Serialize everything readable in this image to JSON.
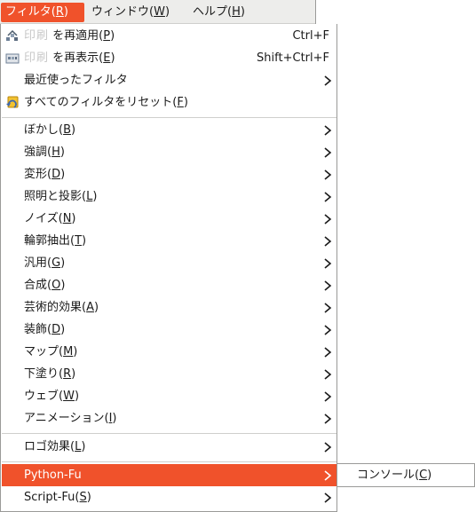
{
  "menubar": {
    "items": [
      {
        "label": "フィルタ(R)",
        "active": true
      },
      {
        "label": "ウィンドウ(W)",
        "active": false
      },
      {
        "label": "ヘルプ(H)",
        "active": false
      }
    ]
  },
  "menu": {
    "reapply": {
      "ghost": "印刷",
      "label": " を再適用(P)",
      "accel": "Ctrl+F"
    },
    "reshow": {
      "ghost": "印刷",
      "label": " を再表示(E)",
      "accel": "Shift+Ctrl+F"
    },
    "recent": {
      "label": "最近使ったフィルタ"
    },
    "reset": {
      "label": "すべてのフィルタをリセット(F)"
    },
    "categories": [
      "ぼかし(B)",
      "強調(H)",
      "変形(D)",
      "照明と投影(L)",
      "ノイズ(N)",
      "輪郭抽出(T)",
      "汎用(G)",
      "合成(O)",
      "芸術的効果(A)",
      "装飾(D)",
      "マップ(M)",
      "下塗り(R)",
      "ウェブ(W)",
      "アニメーション(I)"
    ],
    "logo": "ロゴ効果(L)",
    "python_fu": "Python-Fu",
    "script_fu": "Script-Fu(S)"
  },
  "submenu": {
    "console": "コンソール(C)"
  },
  "colors": {
    "accent": "#f0522b",
    "menubar_bg": "#ededeb",
    "separator": "#cfcfcd",
    "border": "#9a9a98"
  },
  "icons": {
    "reapply": "filter-reapply-icon",
    "reshow": "filter-reshow-icon",
    "reset": "reset-filters-icon",
    "submenu_arrow": "chevron-right-icon"
  }
}
